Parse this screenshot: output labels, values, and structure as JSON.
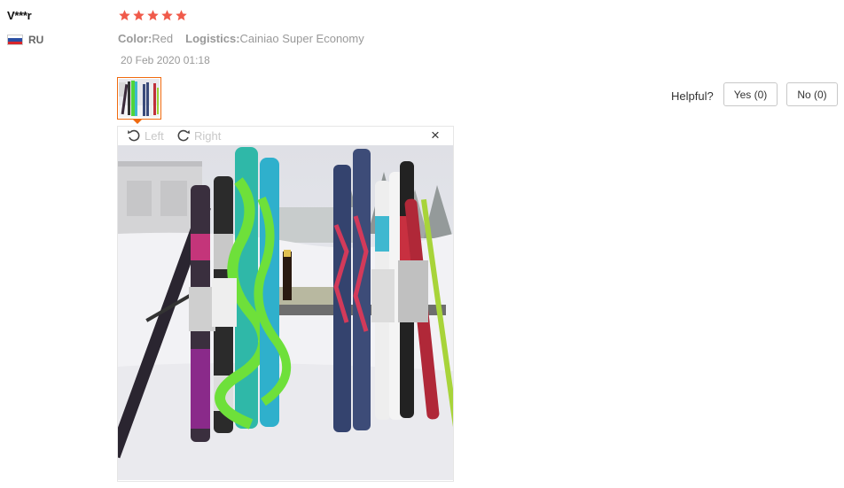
{
  "review": {
    "username": "V***r",
    "country": "RU",
    "rating": 5,
    "attributes": [
      {
        "key": "Color:",
        "value": "Red"
      },
      {
        "key": "Logistics:",
        "value": "Cainiao Super Economy"
      }
    ],
    "date": "20 Feb 2020 01:18"
  },
  "helpful": {
    "label": "Helpful?",
    "yes_label": "Yes (0)",
    "no_label": "No (0)"
  },
  "viewer": {
    "rotate_left_label": "Left",
    "rotate_right_label": "Right",
    "close_glyph": "×"
  },
  "icons": [
    "russia-flag-icon",
    "star-icon",
    "rotate-left-icon",
    "rotate-right-icon",
    "close-icon"
  ],
  "colors": {
    "star": "#f05a4a",
    "accent": "#f06a0f",
    "muted_text": "#999999"
  }
}
